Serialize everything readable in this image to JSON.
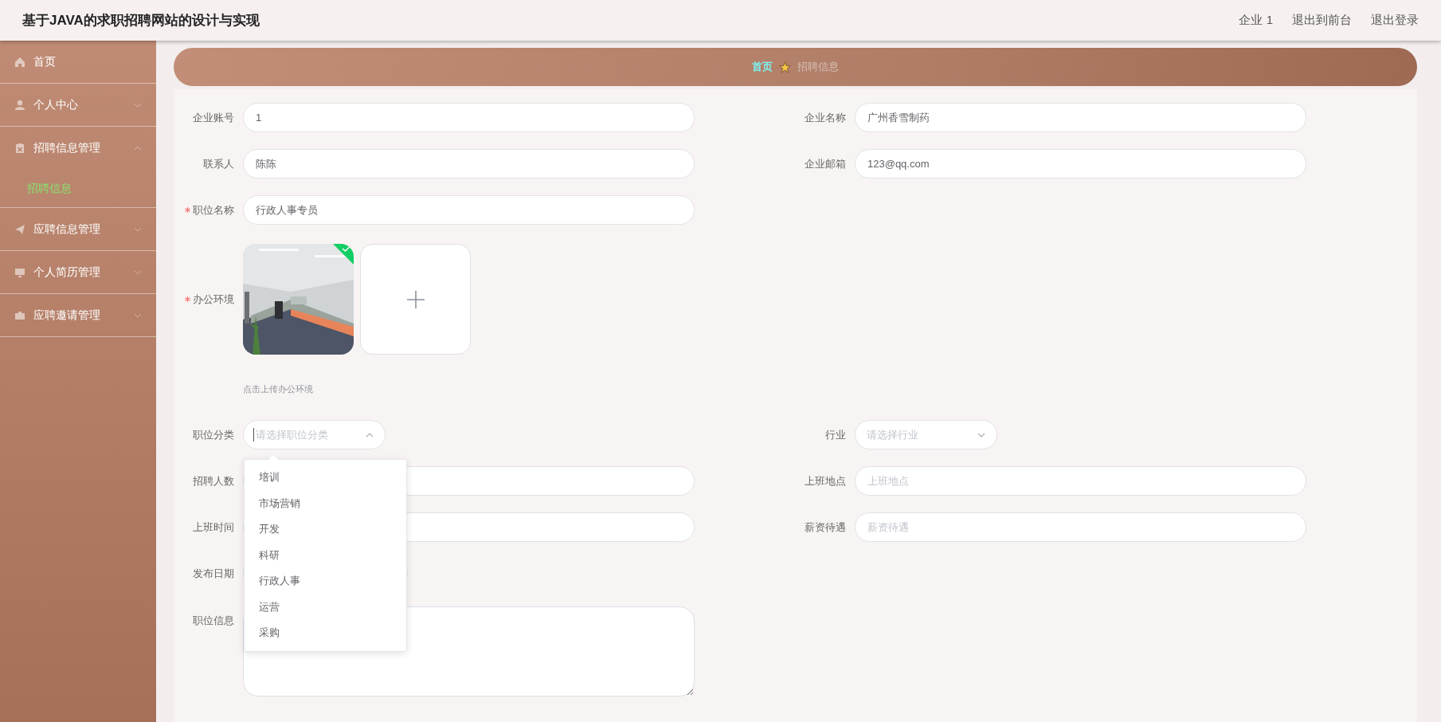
{
  "header": {
    "title": "基于JAVA的求职招聘网站的设计与实现",
    "links": [
      "企业 1",
      "退出到前台",
      "退出登录"
    ]
  },
  "sidebar": {
    "items": [
      {
        "label": "首页",
        "kind": "link",
        "selected": false
      },
      {
        "label": "个人中心",
        "kind": "submenu",
        "expanded": false
      },
      {
        "label": "招聘信息管理",
        "kind": "submenu",
        "expanded": true,
        "children": [
          {
            "label": "招聘信息",
            "selected": true
          }
        ]
      },
      {
        "label": "应聘信息管理",
        "kind": "submenu",
        "expanded": false
      },
      {
        "label": "个人简历管理",
        "kind": "submenu",
        "expanded": false
      },
      {
        "label": "应聘邀请管理",
        "kind": "submenu",
        "expanded": false
      }
    ]
  },
  "breadcrumb": [
    {
      "label": "首页",
      "current": false
    },
    {
      "label": "招聘信息",
      "current": true
    }
  ],
  "form": {
    "rows": [
      {
        "fields": [
          {
            "label": "企业账号",
            "kind": "text",
            "value": "1",
            "required": false
          },
          {
            "label": "企业名称",
            "kind": "text",
            "value": "广州香雪制药",
            "required": false
          }
        ]
      },
      {
        "fields": [
          {
            "label": "联系人",
            "kind": "text",
            "value": "陈陈",
            "required": false
          },
          {
            "label": "企业邮箱",
            "kind": "text",
            "value": "123@qq.com",
            "required": false
          }
        ]
      },
      {
        "fields": [
          {
            "label": "职位名称",
            "kind": "text",
            "value": "行政人事专员",
            "required": true
          }
        ]
      },
      {
        "fields": [
          {
            "label": "办公环境",
            "kind": "upload",
            "required": true,
            "images": [
              {
                "kind": "picture",
                "uploaded": true
              }
            ],
            "hint": "点击上传办公环境"
          }
        ]
      },
      {
        "fields": [
          {
            "label": "职位分类",
            "kind": "select",
            "placeholder": "请选择职位分类",
            "required": false,
            "open": true,
            "options": [
              "培训",
              "市场营销",
              "开发",
              "科研",
              "行政人事",
              "运营",
              "采购"
            ]
          },
          {
            "label": "行业",
            "kind": "select",
            "placeholder": "请选择行业",
            "required": false,
            "open": false
          }
        ]
      },
      {
        "fields": [
          {
            "label": "招聘人数",
            "kind": "text",
            "required": false
          },
          {
            "label": "上班地点",
            "kind": "text",
            "placeholder": "上班地点",
            "required": false
          }
        ]
      },
      {
        "fields": [
          {
            "label": "上班时间",
            "kind": "text",
            "required": false
          },
          {
            "label": "薪资待遇",
            "kind": "text",
            "placeholder": "薪资待遇",
            "required": false
          }
        ]
      },
      {
        "fields": [
          {
            "label": "发布日期",
            "kind": "date",
            "required": false
          }
        ]
      },
      {
        "fields": [
          {
            "label": "职位信息",
            "kind": "textarea",
            "required": false
          }
        ]
      }
    ]
  }
}
